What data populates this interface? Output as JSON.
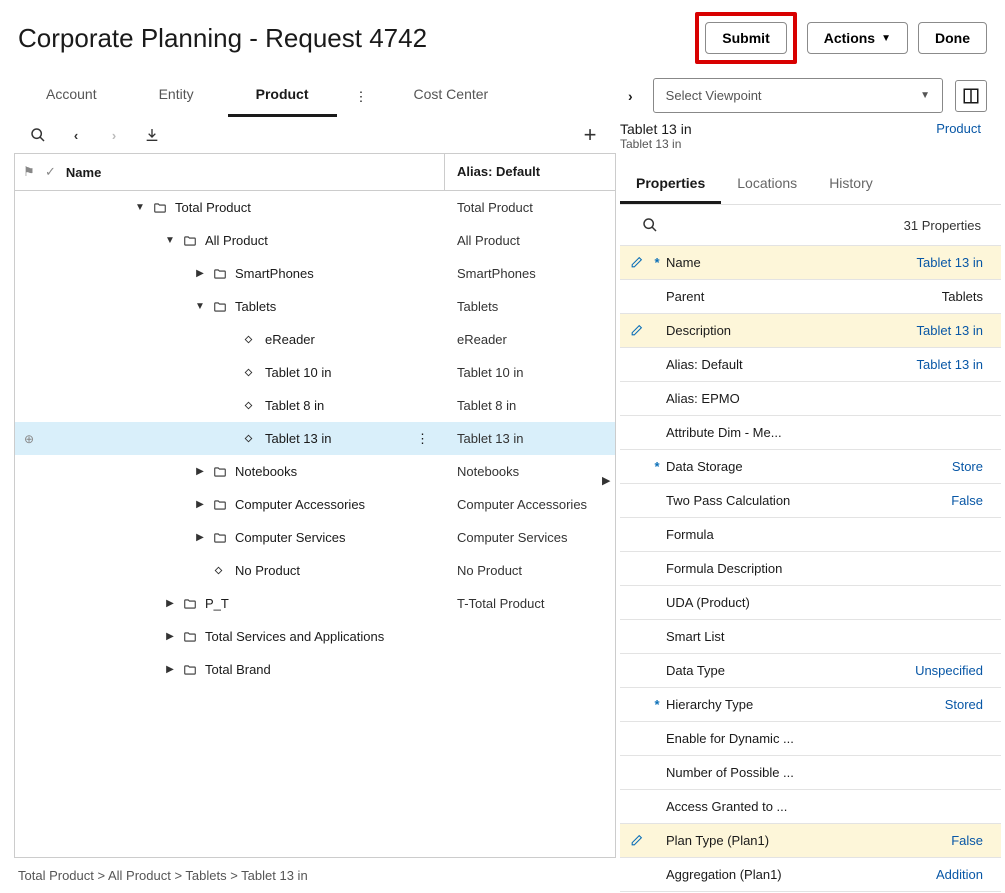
{
  "header": {
    "title": "Corporate Planning - Request 4742",
    "submit": "Submit",
    "actions": "Actions",
    "done": "Done"
  },
  "tabs": [
    "Account",
    "Entity",
    "Product",
    "Cost Center"
  ],
  "active_tab_index": 2,
  "tree": {
    "columns": {
      "name": "Name",
      "alias": "Alias: Default"
    },
    "rows": [
      {
        "level": 2,
        "expand": "down",
        "icon": "folder",
        "name": "Total Product",
        "alias": "Total Product"
      },
      {
        "level": 3,
        "expand": "down",
        "icon": "folder",
        "name": "All Product",
        "alias": "All Product"
      },
      {
        "level": 4,
        "expand": "right",
        "icon": "folder",
        "name": "SmartPhones",
        "alias": "SmartPhones"
      },
      {
        "level": 4,
        "expand": "down",
        "icon": "folder",
        "name": "Tablets",
        "alias": "Tablets"
      },
      {
        "level": 5,
        "expand": "none",
        "icon": "diamond",
        "name": "eReader",
        "alias": "eReader"
      },
      {
        "level": 5,
        "expand": "none",
        "icon": "diamond",
        "name": "Tablet 10 in",
        "alias": "Tablet 10 in"
      },
      {
        "level": 5,
        "expand": "none",
        "icon": "diamond",
        "name": "Tablet 8 in",
        "alias": "Tablet 8 in"
      },
      {
        "level": 5,
        "expand": "none",
        "icon": "diamond",
        "name": "Tablet 13 in",
        "alias": "Tablet 13 in",
        "selected": true
      },
      {
        "level": 4,
        "expand": "right",
        "icon": "folder",
        "name": "Notebooks",
        "alias": "Notebooks"
      },
      {
        "level": 4,
        "expand": "right",
        "icon": "folder",
        "name": "Computer Accessories",
        "alias": "Computer Accessories"
      },
      {
        "level": 4,
        "expand": "right",
        "icon": "folder",
        "name": "Computer Services",
        "alias": "Computer Services"
      },
      {
        "level": 4,
        "expand": "none",
        "icon": "diamond",
        "name": "No Product",
        "alias": "No Product"
      },
      {
        "level": 3,
        "expand": "right",
        "icon": "folder",
        "name": "P_T",
        "alias": "T-Total Product"
      },
      {
        "level": 3,
        "expand": "right",
        "icon": "folder",
        "name": "Total Services and Applications",
        "alias": ""
      },
      {
        "level": 3,
        "expand": "right",
        "icon": "folder",
        "name": "Total Brand",
        "alias": ""
      }
    ]
  },
  "breadcrumb": "Total Product > All Product > Tablets > Tablet 13 in",
  "right": {
    "viewpoint_placeholder": "Select Viewpoint",
    "title": "Tablet 13 in",
    "subtitle": "Tablet 13 in",
    "type_link": "Product",
    "tabs": [
      "Properties",
      "Locations",
      "History"
    ],
    "active_tab_index": 0,
    "prop_count": "31 Properties",
    "properties": [
      {
        "label": "Name",
        "value": "Tablet 13 in",
        "link": true,
        "editable": true,
        "required": true
      },
      {
        "label": "Parent",
        "value": "Tablets",
        "link": false,
        "editable": false
      },
      {
        "label": "Description",
        "value": "Tablet 13 in",
        "link": true,
        "editable": true
      },
      {
        "label": "Alias: Default",
        "value": "Tablet 13 in",
        "link": true,
        "editable": false
      },
      {
        "label": "Alias: EPMO",
        "value": "",
        "editable": false
      },
      {
        "label": "Attribute Dim - Me...",
        "value": "",
        "editable": false
      },
      {
        "label": "Data Storage",
        "value": "Store",
        "link": true,
        "editable": false,
        "required": true
      },
      {
        "label": "Two Pass Calculation",
        "value": "False",
        "link": true,
        "editable": false
      },
      {
        "label": "Formula",
        "value": "",
        "editable": false
      },
      {
        "label": "Formula Description",
        "value": "",
        "editable": false
      },
      {
        "label": "UDA (Product)",
        "value": "",
        "editable": false
      },
      {
        "label": "Smart List",
        "value": "",
        "editable": false
      },
      {
        "label": "Data Type",
        "value": "Unspecified",
        "link": true,
        "editable": false
      },
      {
        "label": "Hierarchy Type",
        "value": "Stored",
        "link": true,
        "editable": false,
        "required": true
      },
      {
        "label": "Enable for Dynamic ...",
        "value": "",
        "editable": false
      },
      {
        "label": "Number of Possible ...",
        "value": "",
        "editable": false
      },
      {
        "label": "Access Granted to ...",
        "value": "",
        "editable": false
      },
      {
        "label": "Plan Type (Plan1)",
        "value": "False",
        "link": true,
        "editable": true
      },
      {
        "label": "Aggregation (Plan1)",
        "value": "Addition",
        "link": true,
        "editable": false
      }
    ]
  }
}
